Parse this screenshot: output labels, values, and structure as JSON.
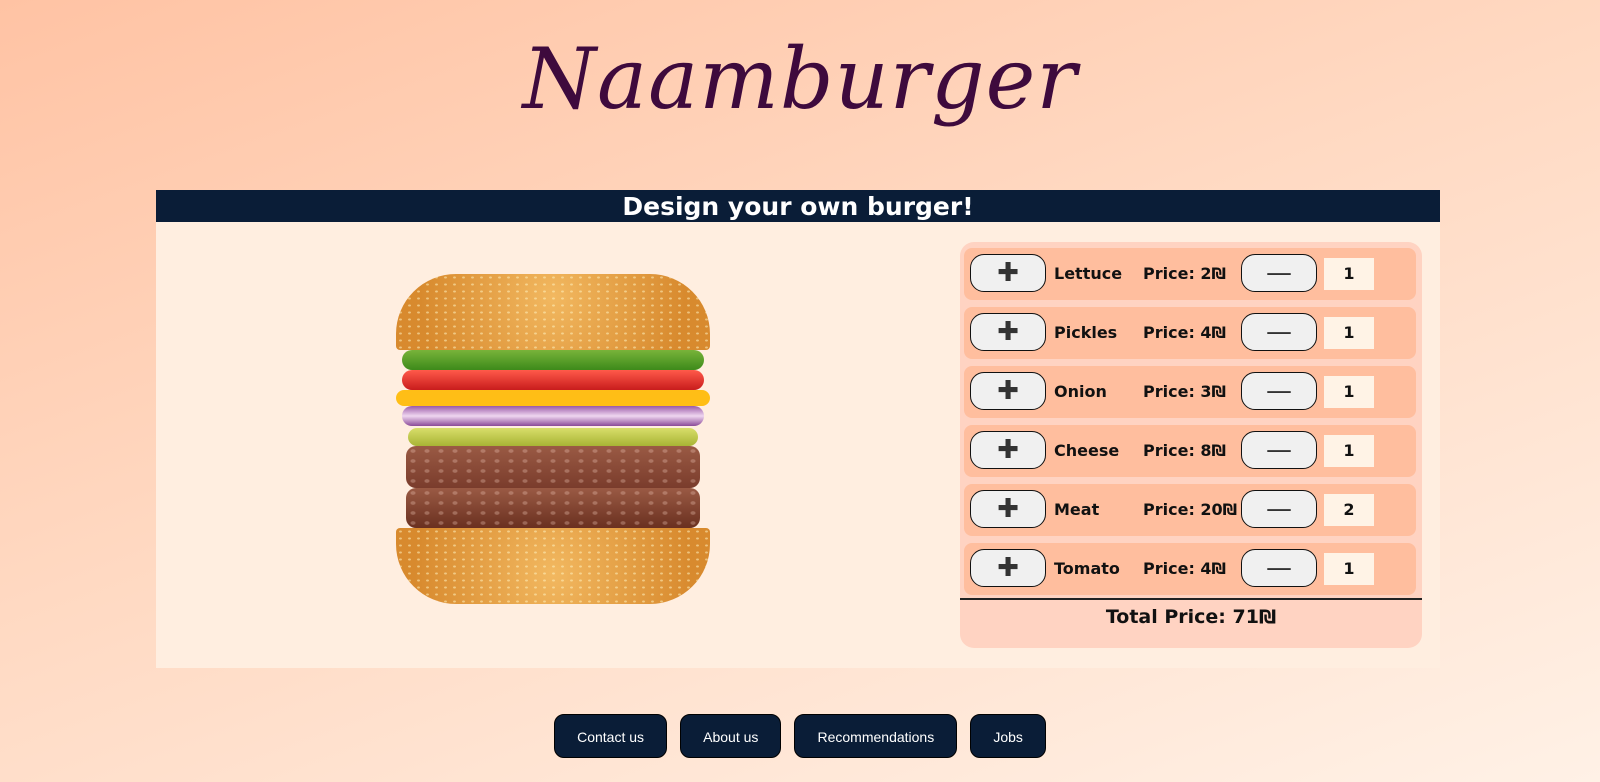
{
  "brand": {
    "logo": "Naamburger"
  },
  "builder": {
    "title": "Design your own burger!",
    "ingredients": [
      {
        "name": "Lettuce",
        "price": "Price: 2₪",
        "qty": "1"
      },
      {
        "name": "Pickles",
        "price": "Price: 4₪",
        "qty": "1"
      },
      {
        "name": "Onion",
        "price": "Price: 3₪",
        "qty": "1"
      },
      {
        "name": "Cheese",
        "price": "Price: 8₪",
        "qty": "1"
      },
      {
        "name": "Meat",
        "price": "Price: 20₪",
        "qty": "2"
      },
      {
        "name": "Tomato",
        "price": "Price: 4₪",
        "qty": "1"
      }
    ],
    "plus_symbol": "✚",
    "minus_symbol": "—",
    "total": "Total Price: 71₪"
  },
  "footer": {
    "contact": "Contact us",
    "about": "About us",
    "recommendations": "Recommendations",
    "jobs": "Jobs"
  },
  "colors": {
    "header": "#0a1d37",
    "logo": "#3e0a3d",
    "panel": "#ffeee0",
    "row": "#ffbe9e"
  }
}
